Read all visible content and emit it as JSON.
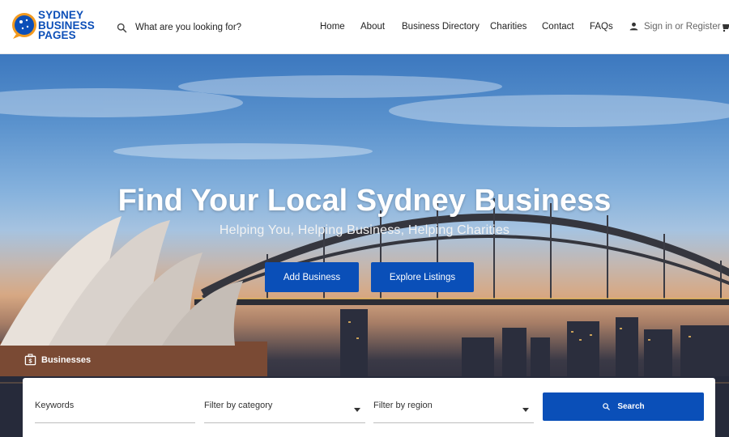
{
  "site": {
    "logo_lines": [
      "SYDNEY",
      "BUSINESS",
      "PAGES"
    ]
  },
  "header": {
    "search_placeholder": "What are you looking for?",
    "nav": [
      "Home",
      "About",
      "Business Directory",
      "Charities",
      "Contact",
      "FAQs"
    ],
    "signin_label": "Sign in or Register"
  },
  "hero": {
    "title": "Find Your Local Sydney Business",
    "subtitle": "Helping You, Helping Business, Helping Charities",
    "buttons": [
      "Add Business",
      "Explore Listings"
    ],
    "tab_label": "Businesses"
  },
  "search_panel": {
    "keywords_placeholder": "Keywords",
    "category_placeholder": "Filter by category",
    "region_placeholder": "Filter by region",
    "search_label": "Search"
  },
  "colors": {
    "brand_blue": "#0a4fb8",
    "logo_orange": "#f29a1f"
  },
  "icons": [
    "search-icon",
    "user-icon",
    "cart-icon",
    "briefcase-dollar-icon",
    "chevron-down-icon"
  ]
}
